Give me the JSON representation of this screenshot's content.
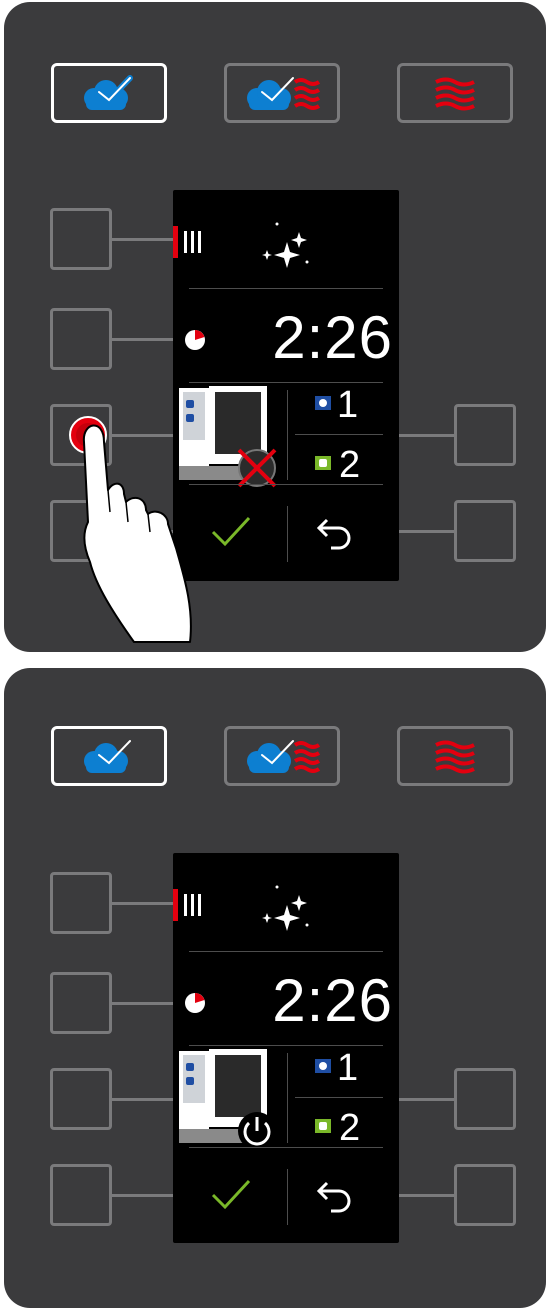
{
  "panels": [
    {
      "modes": [
        {
          "icon": "steam-icon",
          "selected": true
        },
        {
          "icon": "combi-steam-hot-air-icon",
          "selected": false
        },
        {
          "icon": "hot-air-icon",
          "selected": false
        }
      ],
      "screen": {
        "cleaning_icon": "sparkle-icon",
        "timer_icon": "clock-icon",
        "timer": "2:26",
        "unit_icon": "oven-unit-icon",
        "power_state_icon": "power-off-crossed-icon",
        "unit_1_label": "1",
        "unit_2_label": "2",
        "confirm_icon": "checkmark-icon",
        "back_icon": "back-arrow-icon"
      },
      "pressed_button": "left-button-3",
      "hand_icon": "pointing-hand-icon"
    },
    {
      "modes": [
        {
          "icon": "steam-icon",
          "selected": true
        },
        {
          "icon": "combi-steam-hot-air-icon",
          "selected": false
        },
        {
          "icon": "hot-air-icon",
          "selected": false
        }
      ],
      "screen": {
        "cleaning_icon": "sparkle-icon",
        "timer_icon": "clock-icon",
        "timer": "2:26",
        "unit_icon": "oven-unit-icon",
        "power_state_icon": "power-on-icon",
        "unit_1_label": "1",
        "unit_2_label": "2",
        "confirm_icon": "checkmark-icon",
        "back_icon": "back-arrow-icon"
      }
    }
  ],
  "colors": {
    "panel": "#3b3b3d",
    "steam_blue": "#0d7fd1",
    "hot_air_red": "#e3000f",
    "check_green": "#7ab829",
    "unit_1_blue": "#1f4ea3",
    "unit_2_green": "#7ab829"
  }
}
